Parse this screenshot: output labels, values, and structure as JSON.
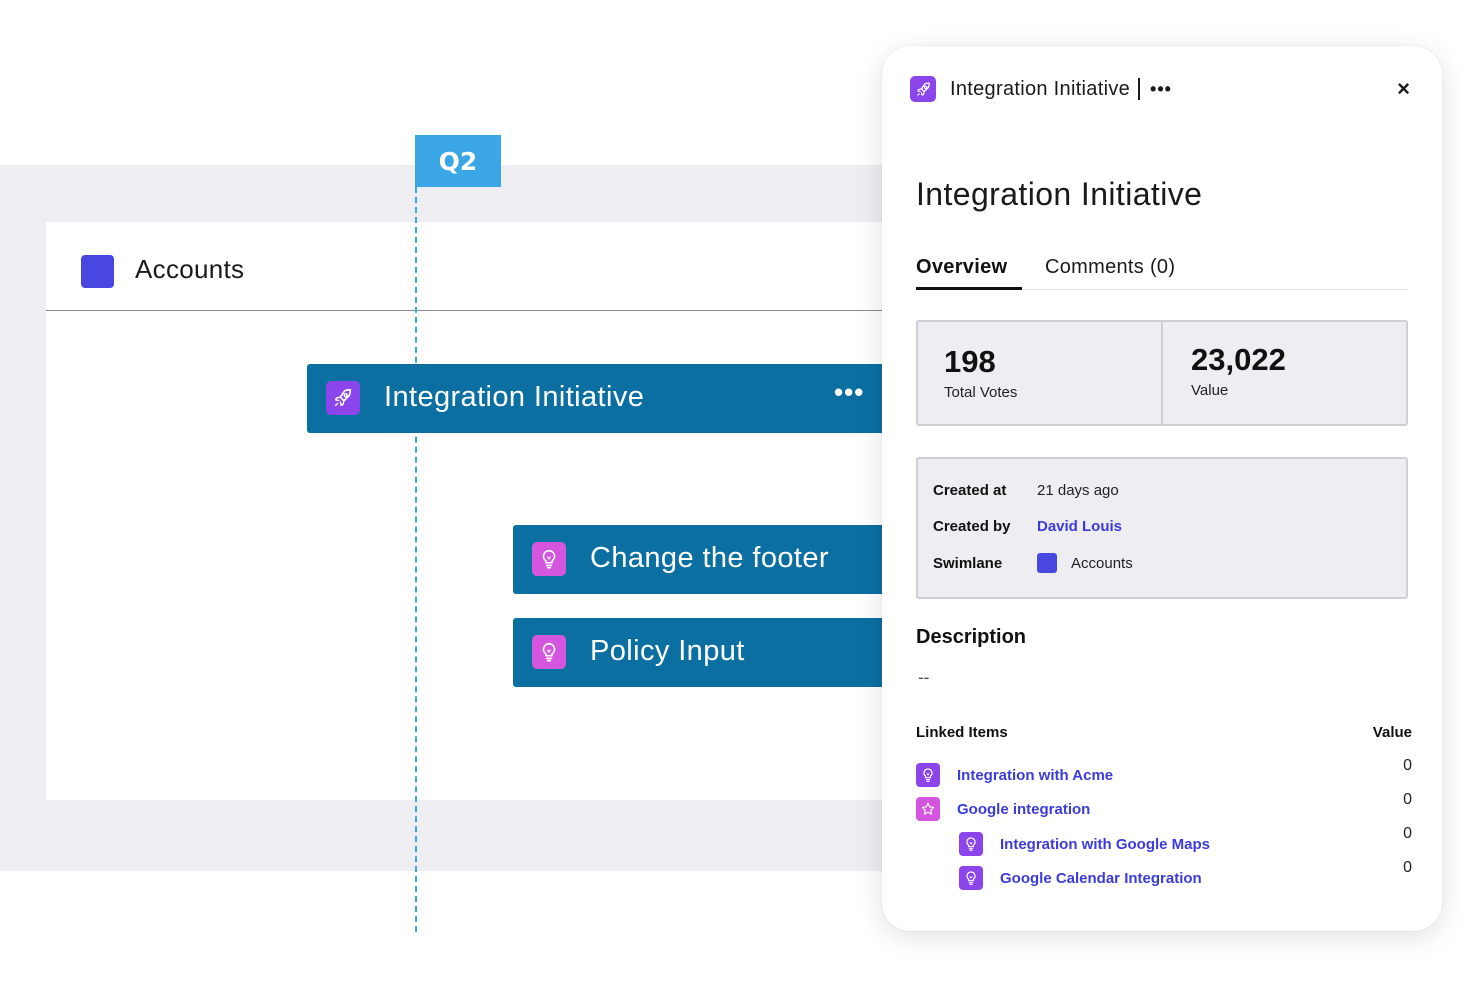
{
  "roadmap": {
    "quarter_marker": "Q2",
    "swimlane": {
      "name": "Accounts",
      "color": "#4848e0"
    },
    "cards": [
      {
        "title": "Integration Initiative",
        "icon": "rocket-icon",
        "more": "•••"
      },
      {
        "title": "Change the footer",
        "icon": "lightbulb-icon"
      },
      {
        "title": "Policy Input",
        "icon": "lightbulb-icon"
      }
    ]
  },
  "panel": {
    "header": {
      "title": "Integration Initiative",
      "icon": "rocket-icon",
      "more": "•••",
      "close": "×"
    },
    "title": "Integration Initiative",
    "tabs": [
      {
        "label": "Overview",
        "active": true
      },
      {
        "label": "Comments (0)",
        "active": false
      }
    ],
    "stats": [
      {
        "value": "198",
        "label": "Total Votes"
      },
      {
        "value": "23,022",
        "label": "Value"
      }
    ],
    "meta": {
      "created_at": {
        "label": "Created at",
        "value": "21 days ago"
      },
      "created_by": {
        "label": "Created by",
        "value": "David Louis"
      },
      "swimlane": {
        "label": "Swimlane",
        "value": "Accounts"
      }
    },
    "description": {
      "heading": "Description",
      "value": "--"
    },
    "linked": {
      "heading": "Linked Items",
      "value_heading": "Value",
      "items": [
        {
          "label": "Integration with Acme",
          "value": "0",
          "icon": "lightbulb-icon"
        },
        {
          "label": "Google integration",
          "value": "0",
          "icon": "star-icon"
        },
        {
          "label": "Integration with Google Maps",
          "value": "0",
          "icon": "lightbulb-icon"
        },
        {
          "label": "Google Calendar Integration",
          "value": "0",
          "icon": "lightbulb-icon"
        }
      ]
    }
  },
  "colors": {
    "card": "#0c6fa2",
    "quarter": "#3aa6e6",
    "link": "#3b3bdc",
    "rocket": "#8b45ea",
    "bulb": "#d556de"
  }
}
